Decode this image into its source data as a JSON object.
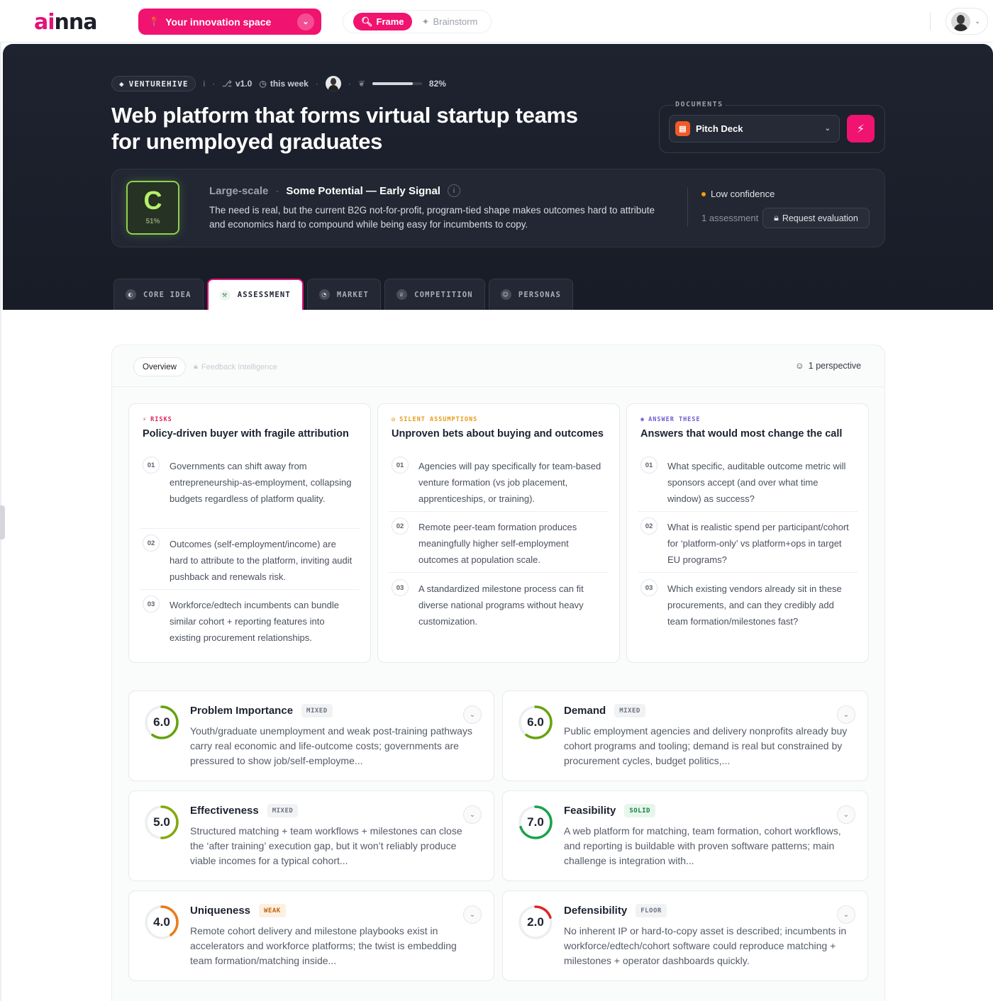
{
  "topbar": {
    "logo_a": "ai",
    "logo_b": "nna",
    "space_label": "Your innovation space",
    "mode_frame": "Frame",
    "mode_brainstorm": "Brainstorm"
  },
  "hero": {
    "tag": "VENTUREHIVE",
    "info": "i",
    "version": "v1.0",
    "time": "this week",
    "progress_text": "82%",
    "progress_value": 0.82,
    "title": "Web platform that forms virtual startup teams for unemployed graduates"
  },
  "documents": {
    "label": "DOCUMENTS",
    "selected": "Pitch Deck"
  },
  "verdict": {
    "grade": "C",
    "grade_pct": "51%",
    "scale": "Large-scale",
    "dot": "·",
    "signal": "Some Potential — Early Signal",
    "description": "The need is real, but the current B2G not-for-profit, program-tied shape makes outcomes hard to attribute and economics hard to compound while being easy for incumbents to copy.",
    "confidence": "Low confidence",
    "assessments": "1 assessment",
    "request_label": "Request evaluation"
  },
  "tabs": [
    {
      "label": "CORE IDEA",
      "icon": "lightbulb-icon"
    },
    {
      "label": "ASSESSMENT",
      "icon": "gavel-icon"
    },
    {
      "label": "MARKET",
      "icon": "pie-chart-icon"
    },
    {
      "label": "COMPETITION",
      "icon": "trophy-icon"
    },
    {
      "label": "PERSONAS",
      "icon": "users-icon"
    }
  ],
  "panel": {
    "overview": "Overview",
    "feedback": "Feedback Intelligence",
    "perspective": "1 perspective"
  },
  "columns": [
    {
      "kicker": "RISKS",
      "kicker_color": "#e0245e",
      "title": "Policy-driven buyer with fragile attribution",
      "items": [
        {
          "num": "01",
          "text": "Governments can shift away from entrepreneurship-as-employment, collapsing budgets regardless of platform quality."
        },
        {
          "num": "02",
          "text": "Outcomes (self-employment/income) are hard to attribute to the platform, inviting audit pushback and renewals risk."
        },
        {
          "num": "03",
          "text": "Workforce/edtech incumbents can bundle similar cohort + reporting features into existing procurement relationships."
        }
      ]
    },
    {
      "kicker": "SILENT ASSUMPTIONS",
      "kicker_color": "#e89b12",
      "title": "Unproven bets about buying and outcomes",
      "items": [
        {
          "num": "01",
          "text": "Agencies will pay specifically for team-based venture formation (vs job placement, apprenticeships, or training)."
        },
        {
          "num": "02",
          "text": "Remote peer-team formation produces meaningfully higher self-employment outcomes at population scale."
        },
        {
          "num": "03",
          "text": "A standardized milestone process can fit diverse national programs without heavy customization."
        }
      ]
    },
    {
      "kicker": "ANSWER THESE",
      "kicker_color": "#6d5bd0",
      "title": "Answers that would most change the call",
      "items": [
        {
          "num": "01",
          "text": "What specific, auditable outcome metric will sponsors accept (and over what time window) as success?"
        },
        {
          "num": "02",
          "text": "What is realistic spend per participant/cohort for ‘platform-only’ vs platform+ops in target EU programs?"
        },
        {
          "num": "03",
          "text": "Which existing vendors already sit in these procurements, and can they credibly add team formation/milestones fast?"
        }
      ]
    }
  ],
  "metrics": [
    {
      "name": "Problem Importance",
      "score": "6.0",
      "score_value": 6.0,
      "badge": "MIXED",
      "color": "#65a30d",
      "desc": "Youth/graduate unemployment and weak post-training pathways carry real economic and life-outcome costs; governments are pressured to show job/self-employme..."
    },
    {
      "name": "Demand",
      "score": "6.0",
      "score_value": 6.0,
      "badge": "MIXED",
      "color": "#65a30d",
      "desc": "Public employment agencies and delivery nonprofits already buy cohort programs and tooling; demand is real but constrained by procurement cycles, budget politics,..."
    },
    {
      "name": "Effectiveness",
      "score": "5.0",
      "score_value": 5.0,
      "badge": "MIXED",
      "color": "#84a80f",
      "desc": "Structured matching + team workflows + milestones can close the ‘after training’ execution gap, but it won’t reliably produce viable incomes for a typical cohort..."
    },
    {
      "name": "Feasibility",
      "score": "7.0",
      "score_value": 7.0,
      "badge": "SOLID",
      "color": "#16a34a",
      "desc": "A web platform for matching, team formation, cohort workflows, and reporting is buildable with proven software patterns; main challenge is integration with..."
    },
    {
      "name": "Uniqueness",
      "score": "4.0",
      "score_value": 4.0,
      "badge": "WEAK",
      "color": "#ea7b1a",
      "desc": "Remote cohort delivery and milestone playbooks exist in accelerators and workforce platforms; the twist is embedding team formation/matching inside..."
    },
    {
      "name": "Defensibility",
      "score": "2.0",
      "score_value": 2.0,
      "badge": "FLOOR",
      "color": "#dc2626",
      "desc": "No inherent IP or hard-to-copy asset is described; incumbents in workforce/edtech/cohort software could reproduce matching + milestones + operator dashboards quickly."
    }
  ],
  "badge_styles": {
    "MIXED": {
      "bg": "#f1f2f4",
      "fg": "#6b7280"
    },
    "SOLID": {
      "bg": "#e7f6ec",
      "fg": "#15803d"
    },
    "WEAK": {
      "bg": "#fdf0e1",
      "fg": "#c2620c"
    },
    "FLOOR": {
      "bg": "#f1f2f4",
      "fg": "#6b7280"
    }
  }
}
